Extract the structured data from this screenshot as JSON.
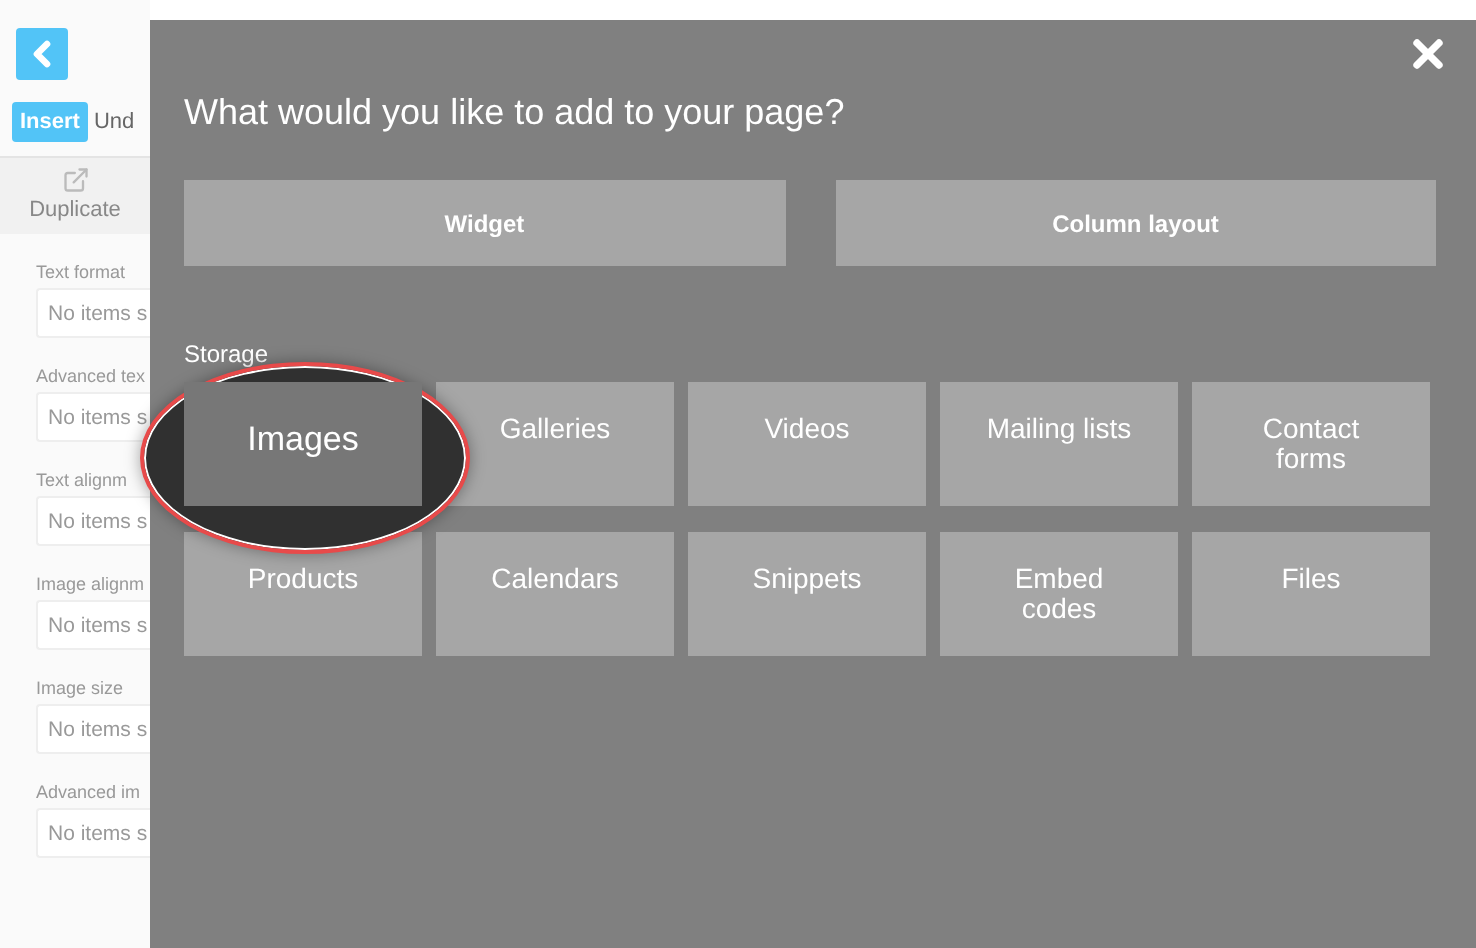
{
  "editor": {
    "mode_buttons": [
      {
        "label": "Insert",
        "selected": true
      },
      {
        "label": "Und",
        "selected": false
      }
    ],
    "duplicate_label": "Duplicate",
    "settings": [
      {
        "label": "Text format",
        "placeholder": "No items s"
      },
      {
        "label": "Advanced tex",
        "placeholder": "No items s"
      },
      {
        "label": "Text alignm",
        "placeholder": "No items s"
      },
      {
        "label": "Image alignm",
        "placeholder": "No items s"
      },
      {
        "label": "Image size",
        "placeholder": "No items s"
      },
      {
        "label": "Advanced im",
        "placeholder": "No items s"
      }
    ]
  },
  "dialog": {
    "title": "What would you like to add to your page?",
    "primary_options": [
      "Widget",
      "Column layout"
    ],
    "section": "Storage",
    "tiles": [
      {
        "label": "Images",
        "highlighted": true
      },
      {
        "label": "Galleries",
        "highlighted": false
      },
      {
        "label": "Videos",
        "highlighted": false
      },
      {
        "label": "Mailing lists",
        "highlighted": false
      },
      {
        "label": "Contact forms",
        "highlighted": false
      },
      {
        "label": "Products",
        "highlighted": false
      },
      {
        "label": "Calendars",
        "highlighted": false
      },
      {
        "label": "Snippets",
        "highlighted": false
      },
      {
        "label": "Embed codes",
        "highlighted": false
      },
      {
        "label": "Files",
        "highlighted": false
      }
    ]
  }
}
